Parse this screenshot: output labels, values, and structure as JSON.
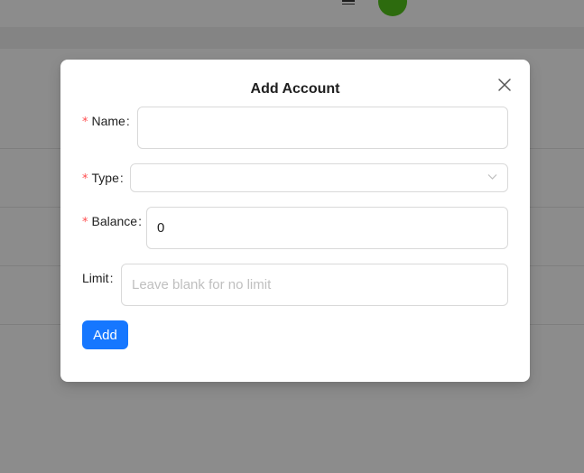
{
  "modal": {
    "title": "Add Account",
    "close_icon": "close-icon",
    "fields": {
      "name": {
        "label": "Name",
        "required_mark": "*",
        "colon": ":",
        "value": ""
      },
      "type": {
        "label": "Type",
        "required_mark": "*",
        "colon": ":",
        "selected": "",
        "icon": "chevron-down-icon"
      },
      "balance": {
        "label": "Balance",
        "required_mark": "*",
        "colon": ":",
        "value": "0"
      },
      "limit": {
        "label": "Limit",
        "colon": ":",
        "value": "",
        "placeholder": "Leave blank for no limit"
      }
    },
    "submit_label": "Add"
  },
  "colors": {
    "primary": "#1677ff",
    "required": "#ff4d4f",
    "avatar": "#52c41a",
    "overlay": "rgba(0,0,0,0.45)"
  }
}
